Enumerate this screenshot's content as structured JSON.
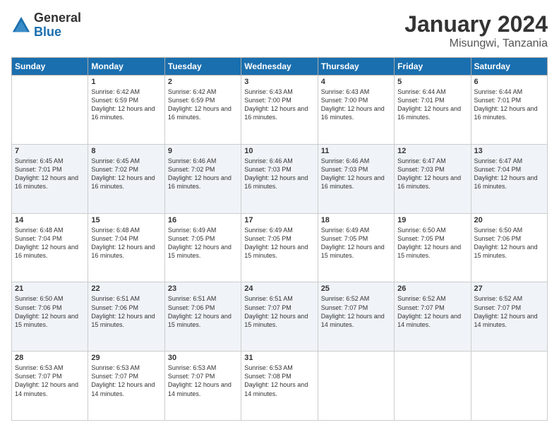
{
  "header": {
    "logo_general": "General",
    "logo_blue": "Blue",
    "month_year": "January 2024",
    "location": "Misungwi, Tanzania"
  },
  "weekdays": [
    "Sunday",
    "Monday",
    "Tuesday",
    "Wednesday",
    "Thursday",
    "Friday",
    "Saturday"
  ],
  "weeks": [
    [
      {
        "day": "",
        "sunrise": "",
        "sunset": "",
        "daylight": ""
      },
      {
        "day": "1",
        "sunrise": "Sunrise: 6:42 AM",
        "sunset": "Sunset: 6:59 PM",
        "daylight": "Daylight: 12 hours and 16 minutes."
      },
      {
        "day": "2",
        "sunrise": "Sunrise: 6:42 AM",
        "sunset": "Sunset: 6:59 PM",
        "daylight": "Daylight: 12 hours and 16 minutes."
      },
      {
        "day": "3",
        "sunrise": "Sunrise: 6:43 AM",
        "sunset": "Sunset: 7:00 PM",
        "daylight": "Daylight: 12 hours and 16 minutes."
      },
      {
        "day": "4",
        "sunrise": "Sunrise: 6:43 AM",
        "sunset": "Sunset: 7:00 PM",
        "daylight": "Daylight: 12 hours and 16 minutes."
      },
      {
        "day": "5",
        "sunrise": "Sunrise: 6:44 AM",
        "sunset": "Sunset: 7:01 PM",
        "daylight": "Daylight: 12 hours and 16 minutes."
      },
      {
        "day": "6",
        "sunrise": "Sunrise: 6:44 AM",
        "sunset": "Sunset: 7:01 PM",
        "daylight": "Daylight: 12 hours and 16 minutes."
      }
    ],
    [
      {
        "day": "7",
        "sunrise": "Sunrise: 6:45 AM",
        "sunset": "Sunset: 7:01 PM",
        "daylight": "Daylight: 12 hours and 16 minutes."
      },
      {
        "day": "8",
        "sunrise": "Sunrise: 6:45 AM",
        "sunset": "Sunset: 7:02 PM",
        "daylight": "Daylight: 12 hours and 16 minutes."
      },
      {
        "day": "9",
        "sunrise": "Sunrise: 6:46 AM",
        "sunset": "Sunset: 7:02 PM",
        "daylight": "Daylight: 12 hours and 16 minutes."
      },
      {
        "day": "10",
        "sunrise": "Sunrise: 6:46 AM",
        "sunset": "Sunset: 7:03 PM",
        "daylight": "Daylight: 12 hours and 16 minutes."
      },
      {
        "day": "11",
        "sunrise": "Sunrise: 6:46 AM",
        "sunset": "Sunset: 7:03 PM",
        "daylight": "Daylight: 12 hours and 16 minutes."
      },
      {
        "day": "12",
        "sunrise": "Sunrise: 6:47 AM",
        "sunset": "Sunset: 7:03 PM",
        "daylight": "Daylight: 12 hours and 16 minutes."
      },
      {
        "day": "13",
        "sunrise": "Sunrise: 6:47 AM",
        "sunset": "Sunset: 7:04 PM",
        "daylight": "Daylight: 12 hours and 16 minutes."
      }
    ],
    [
      {
        "day": "14",
        "sunrise": "Sunrise: 6:48 AM",
        "sunset": "Sunset: 7:04 PM",
        "daylight": "Daylight: 12 hours and 16 minutes."
      },
      {
        "day": "15",
        "sunrise": "Sunrise: 6:48 AM",
        "sunset": "Sunset: 7:04 PM",
        "daylight": "Daylight: 12 hours and 16 minutes."
      },
      {
        "day": "16",
        "sunrise": "Sunrise: 6:49 AM",
        "sunset": "Sunset: 7:05 PM",
        "daylight": "Daylight: 12 hours and 15 minutes."
      },
      {
        "day": "17",
        "sunrise": "Sunrise: 6:49 AM",
        "sunset": "Sunset: 7:05 PM",
        "daylight": "Daylight: 12 hours and 15 minutes."
      },
      {
        "day": "18",
        "sunrise": "Sunrise: 6:49 AM",
        "sunset": "Sunset: 7:05 PM",
        "daylight": "Daylight: 12 hours and 15 minutes."
      },
      {
        "day": "19",
        "sunrise": "Sunrise: 6:50 AM",
        "sunset": "Sunset: 7:05 PM",
        "daylight": "Daylight: 12 hours and 15 minutes."
      },
      {
        "day": "20",
        "sunrise": "Sunrise: 6:50 AM",
        "sunset": "Sunset: 7:06 PM",
        "daylight": "Daylight: 12 hours and 15 minutes."
      }
    ],
    [
      {
        "day": "21",
        "sunrise": "Sunrise: 6:50 AM",
        "sunset": "Sunset: 7:06 PM",
        "daylight": "Daylight: 12 hours and 15 minutes."
      },
      {
        "day": "22",
        "sunrise": "Sunrise: 6:51 AM",
        "sunset": "Sunset: 7:06 PM",
        "daylight": "Daylight: 12 hours and 15 minutes."
      },
      {
        "day": "23",
        "sunrise": "Sunrise: 6:51 AM",
        "sunset": "Sunset: 7:06 PM",
        "daylight": "Daylight: 12 hours and 15 minutes."
      },
      {
        "day": "24",
        "sunrise": "Sunrise: 6:51 AM",
        "sunset": "Sunset: 7:07 PM",
        "daylight": "Daylight: 12 hours and 15 minutes."
      },
      {
        "day": "25",
        "sunrise": "Sunrise: 6:52 AM",
        "sunset": "Sunset: 7:07 PM",
        "daylight": "Daylight: 12 hours and 14 minutes."
      },
      {
        "day": "26",
        "sunrise": "Sunrise: 6:52 AM",
        "sunset": "Sunset: 7:07 PM",
        "daylight": "Daylight: 12 hours and 14 minutes."
      },
      {
        "day": "27",
        "sunrise": "Sunrise: 6:52 AM",
        "sunset": "Sunset: 7:07 PM",
        "daylight": "Daylight: 12 hours and 14 minutes."
      }
    ],
    [
      {
        "day": "28",
        "sunrise": "Sunrise: 6:53 AM",
        "sunset": "Sunset: 7:07 PM",
        "daylight": "Daylight: 12 hours and 14 minutes."
      },
      {
        "day": "29",
        "sunrise": "Sunrise: 6:53 AM",
        "sunset": "Sunset: 7:07 PM",
        "daylight": "Daylight: 12 hours and 14 minutes."
      },
      {
        "day": "30",
        "sunrise": "Sunrise: 6:53 AM",
        "sunset": "Sunset: 7:07 PM",
        "daylight": "Daylight: 12 hours and 14 minutes."
      },
      {
        "day": "31",
        "sunrise": "Sunrise: 6:53 AM",
        "sunset": "Sunset: 7:08 PM",
        "daylight": "Daylight: 12 hours and 14 minutes."
      },
      {
        "day": "",
        "sunrise": "",
        "sunset": "",
        "daylight": ""
      },
      {
        "day": "",
        "sunrise": "",
        "sunset": "",
        "daylight": ""
      },
      {
        "day": "",
        "sunrise": "",
        "sunset": "",
        "daylight": ""
      }
    ]
  ]
}
